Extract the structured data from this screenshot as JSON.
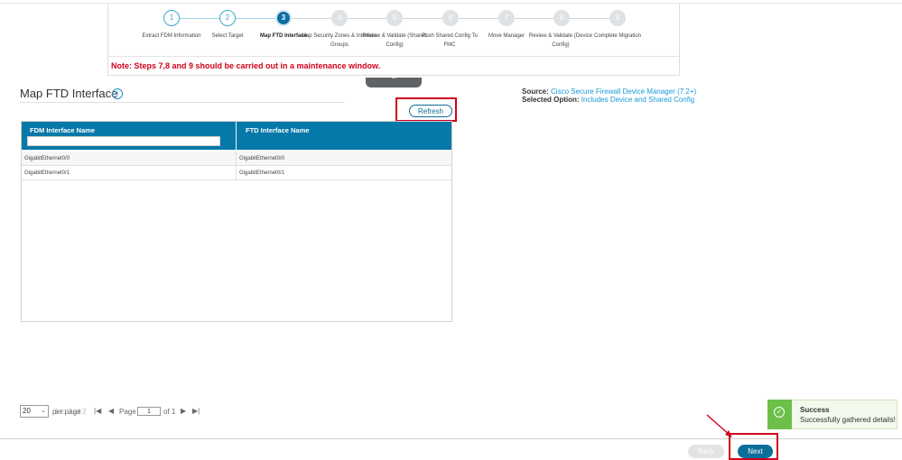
{
  "wizard": {
    "steps": [
      {
        "number": "1",
        "label": "Extract FDM Information",
        "state": "done"
      },
      {
        "number": "2",
        "label": "Select Target",
        "state": "done"
      },
      {
        "number": "3",
        "label": "Map FTD Interface",
        "state": "active"
      },
      {
        "number": "4",
        "label": "Map Security Zones & Interface Groups",
        "state": "todo"
      },
      {
        "number": "5",
        "label": "Review & Validate (Shared Config)",
        "state": "todo"
      },
      {
        "number": "6",
        "label": "Push Shared Config To FMC",
        "state": "todo"
      },
      {
        "number": "7",
        "label": "Move Manager",
        "state": "todo"
      },
      {
        "number": "8",
        "label": "Review & Validate (Device Config)",
        "state": "todo"
      },
      {
        "number": "9",
        "label": "Complete Migration",
        "state": "todo"
      }
    ],
    "note": "Note: Steps 7,8 and 9 should be carried out in a maintenance window."
  },
  "page": {
    "title": "Map FTD Interface",
    "info_icon": "i"
  },
  "source": {
    "source_label": "Source:",
    "source_value": "Cisco Secure Firewall Device Manager (7.2+)",
    "option_label": "Selected Option:",
    "option_value": "Includes Device and Shared Config"
  },
  "toolbar": {
    "refresh_label": "Refresh"
  },
  "table": {
    "columns": [
      "FDM Interface Name",
      "FTD Interface Name"
    ],
    "filter_value": "",
    "rows": [
      [
        "GigabitEthernet0/0",
        "GigabitEthernet0/0"
      ],
      [
        "GigabitEthernet0/1",
        "GigabitEthernet0/1"
      ]
    ]
  },
  "pagination": {
    "per_page_value": "20",
    "per_page_label": "per page",
    "ghost_count": "1 to 2 of 2",
    "page_label": "Page",
    "page_value": "1",
    "of_label": "of 1"
  },
  "toast": {
    "title": "Success",
    "message": "Successfully gathered details!"
  },
  "footer": {
    "back_label": "Back",
    "next_label": "Next"
  },
  "colors": {
    "primary": "#0b6f9a",
    "table_header": "#0579a8",
    "highlight": "#d0021b",
    "success": "#6cc04a"
  }
}
